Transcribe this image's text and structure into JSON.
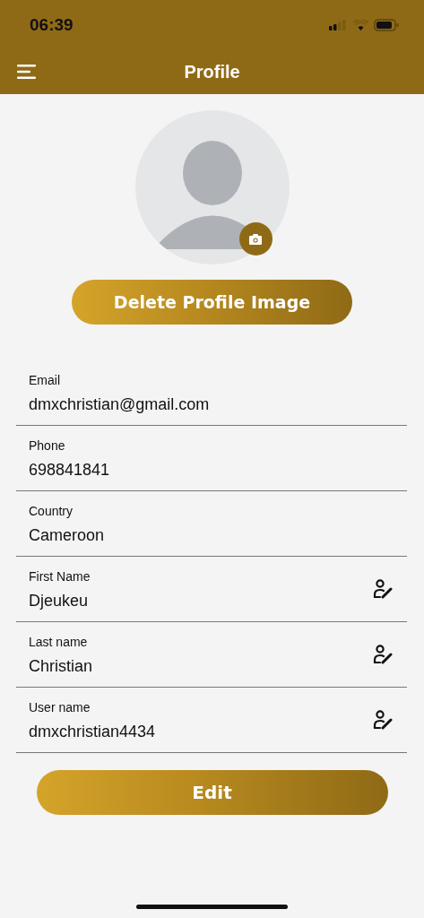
{
  "status_bar": {
    "time": "06:39"
  },
  "header": {
    "title": "Profile"
  },
  "avatar_actions": {
    "delete_label": "Delete Profile Image"
  },
  "fields": [
    {
      "label": "Email",
      "value": "dmxchristian@gmail.com",
      "editable": false
    },
    {
      "label": "Phone",
      "value": "698841841",
      "editable": false
    },
    {
      "label": "Country",
      "value": "Cameroon",
      "editable": false
    },
    {
      "label": "First Name",
      "value": "Djeukeu",
      "editable": true
    },
    {
      "label": "Last name",
      "value": "Christian",
      "editable": true
    },
    {
      "label": "User name",
      "value": "dmxchristian4434",
      "editable": true
    }
  ],
  "edit_button": {
    "label": "Edit"
  }
}
